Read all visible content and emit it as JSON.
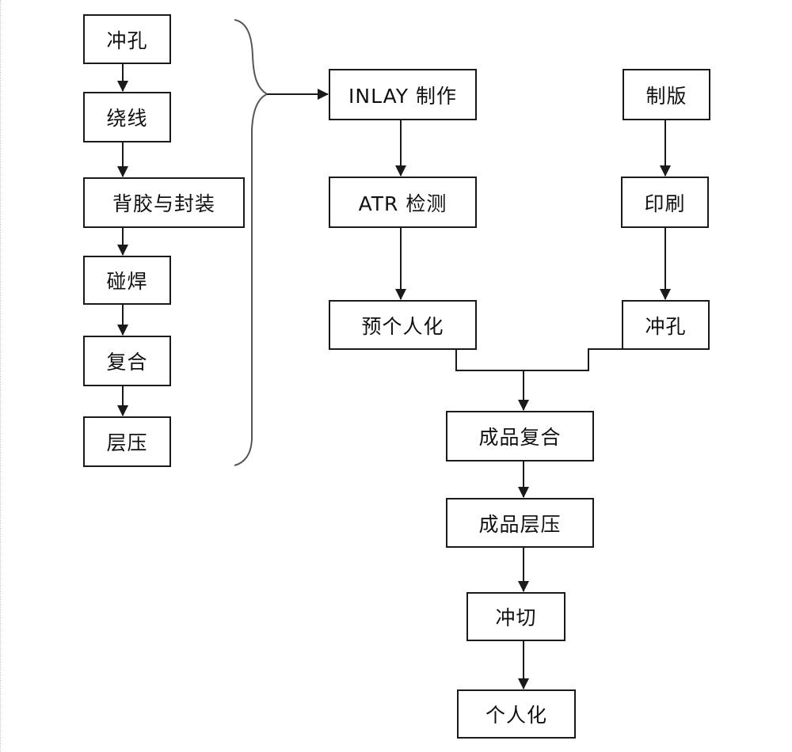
{
  "diagram": {
    "title": "",
    "left_column": [
      {
        "id": "l1",
        "label": "冲孔"
      },
      {
        "id": "l2",
        "label": "绕线"
      },
      {
        "id": "l3",
        "label": "背胶与封装"
      },
      {
        "id": "l4",
        "label": "碰焊"
      },
      {
        "id": "l5",
        "label": "复合"
      },
      {
        "id": "l6",
        "label": "层压"
      }
    ],
    "inlay_branch": [
      {
        "id": "m1",
        "label": "INLAY 制作"
      },
      {
        "id": "m2",
        "label": "ATR 检测"
      },
      {
        "id": "m3",
        "label": "预个人化"
      }
    ],
    "print_branch": [
      {
        "id": "r1",
        "label": "制版"
      },
      {
        "id": "r2",
        "label": "印刷"
      },
      {
        "id": "r3",
        "label": "冲孔"
      }
    ],
    "final_chain": [
      {
        "id": "f1",
        "label": "成品复合"
      },
      {
        "id": "f2",
        "label": "成品层压"
      },
      {
        "id": "f3",
        "label": "冲切"
      },
      {
        "id": "f4",
        "label": "个人化"
      }
    ],
    "edges": [
      {
        "from": "l1",
        "to": "l2"
      },
      {
        "from": "l2",
        "to": "l3"
      },
      {
        "from": "l3",
        "to": "l4"
      },
      {
        "from": "l4",
        "to": "l5"
      },
      {
        "from": "l5",
        "to": "l6"
      },
      {
        "from": "left_column_group",
        "to": "m1",
        "style": "brace"
      },
      {
        "from": "m1",
        "to": "m2"
      },
      {
        "from": "m2",
        "to": "m3"
      },
      {
        "from": "r1",
        "to": "r2"
      },
      {
        "from": "r2",
        "to": "r3"
      },
      {
        "from": [
          "m3",
          "r3"
        ],
        "to": "f1",
        "style": "merge"
      },
      {
        "from": "f1",
        "to": "f2"
      },
      {
        "from": "f2",
        "to": "f3"
      },
      {
        "from": "f3",
        "to": "f4"
      }
    ],
    "colors": {
      "stroke": "#1a1a1a",
      "fill": "#ffffff",
      "text": "#111111"
    }
  }
}
